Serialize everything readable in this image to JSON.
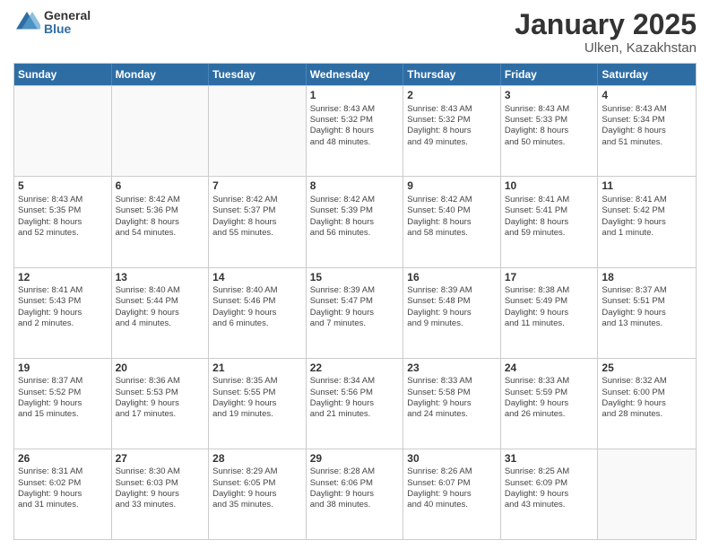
{
  "logo": {
    "general": "General",
    "blue": "Blue"
  },
  "title": {
    "month": "January 2025",
    "location": "Ulken, Kazakhstan"
  },
  "calendar": {
    "headers": [
      "Sunday",
      "Monday",
      "Tuesday",
      "Wednesday",
      "Thursday",
      "Friday",
      "Saturday"
    ],
    "rows": [
      [
        {
          "day": "",
          "info": "",
          "empty": true
        },
        {
          "day": "",
          "info": "",
          "empty": true
        },
        {
          "day": "",
          "info": "",
          "empty": true
        },
        {
          "day": "1",
          "info": "Sunrise: 8:43 AM\nSunset: 5:32 PM\nDaylight: 8 hours\nand 48 minutes.",
          "empty": false
        },
        {
          "day": "2",
          "info": "Sunrise: 8:43 AM\nSunset: 5:32 PM\nDaylight: 8 hours\nand 49 minutes.",
          "empty": false
        },
        {
          "day": "3",
          "info": "Sunrise: 8:43 AM\nSunset: 5:33 PM\nDaylight: 8 hours\nand 50 minutes.",
          "empty": false
        },
        {
          "day": "4",
          "info": "Sunrise: 8:43 AM\nSunset: 5:34 PM\nDaylight: 8 hours\nand 51 minutes.",
          "empty": false
        }
      ],
      [
        {
          "day": "5",
          "info": "Sunrise: 8:43 AM\nSunset: 5:35 PM\nDaylight: 8 hours\nand 52 minutes.",
          "empty": false
        },
        {
          "day": "6",
          "info": "Sunrise: 8:42 AM\nSunset: 5:36 PM\nDaylight: 8 hours\nand 54 minutes.",
          "empty": false
        },
        {
          "day": "7",
          "info": "Sunrise: 8:42 AM\nSunset: 5:37 PM\nDaylight: 8 hours\nand 55 minutes.",
          "empty": false
        },
        {
          "day": "8",
          "info": "Sunrise: 8:42 AM\nSunset: 5:39 PM\nDaylight: 8 hours\nand 56 minutes.",
          "empty": false
        },
        {
          "day": "9",
          "info": "Sunrise: 8:42 AM\nSunset: 5:40 PM\nDaylight: 8 hours\nand 58 minutes.",
          "empty": false
        },
        {
          "day": "10",
          "info": "Sunrise: 8:41 AM\nSunset: 5:41 PM\nDaylight: 8 hours\nand 59 minutes.",
          "empty": false
        },
        {
          "day": "11",
          "info": "Sunrise: 8:41 AM\nSunset: 5:42 PM\nDaylight: 9 hours\nand 1 minute.",
          "empty": false
        }
      ],
      [
        {
          "day": "12",
          "info": "Sunrise: 8:41 AM\nSunset: 5:43 PM\nDaylight: 9 hours\nand 2 minutes.",
          "empty": false
        },
        {
          "day": "13",
          "info": "Sunrise: 8:40 AM\nSunset: 5:44 PM\nDaylight: 9 hours\nand 4 minutes.",
          "empty": false
        },
        {
          "day": "14",
          "info": "Sunrise: 8:40 AM\nSunset: 5:46 PM\nDaylight: 9 hours\nand 6 minutes.",
          "empty": false
        },
        {
          "day": "15",
          "info": "Sunrise: 8:39 AM\nSunset: 5:47 PM\nDaylight: 9 hours\nand 7 minutes.",
          "empty": false
        },
        {
          "day": "16",
          "info": "Sunrise: 8:39 AM\nSunset: 5:48 PM\nDaylight: 9 hours\nand 9 minutes.",
          "empty": false
        },
        {
          "day": "17",
          "info": "Sunrise: 8:38 AM\nSunset: 5:49 PM\nDaylight: 9 hours\nand 11 minutes.",
          "empty": false
        },
        {
          "day": "18",
          "info": "Sunrise: 8:37 AM\nSunset: 5:51 PM\nDaylight: 9 hours\nand 13 minutes.",
          "empty": false
        }
      ],
      [
        {
          "day": "19",
          "info": "Sunrise: 8:37 AM\nSunset: 5:52 PM\nDaylight: 9 hours\nand 15 minutes.",
          "empty": false
        },
        {
          "day": "20",
          "info": "Sunrise: 8:36 AM\nSunset: 5:53 PM\nDaylight: 9 hours\nand 17 minutes.",
          "empty": false
        },
        {
          "day": "21",
          "info": "Sunrise: 8:35 AM\nSunset: 5:55 PM\nDaylight: 9 hours\nand 19 minutes.",
          "empty": false
        },
        {
          "day": "22",
          "info": "Sunrise: 8:34 AM\nSunset: 5:56 PM\nDaylight: 9 hours\nand 21 minutes.",
          "empty": false
        },
        {
          "day": "23",
          "info": "Sunrise: 8:33 AM\nSunset: 5:58 PM\nDaylight: 9 hours\nand 24 minutes.",
          "empty": false
        },
        {
          "day": "24",
          "info": "Sunrise: 8:33 AM\nSunset: 5:59 PM\nDaylight: 9 hours\nand 26 minutes.",
          "empty": false
        },
        {
          "day": "25",
          "info": "Sunrise: 8:32 AM\nSunset: 6:00 PM\nDaylight: 9 hours\nand 28 minutes.",
          "empty": false
        }
      ],
      [
        {
          "day": "26",
          "info": "Sunrise: 8:31 AM\nSunset: 6:02 PM\nDaylight: 9 hours\nand 31 minutes.",
          "empty": false
        },
        {
          "day": "27",
          "info": "Sunrise: 8:30 AM\nSunset: 6:03 PM\nDaylight: 9 hours\nand 33 minutes.",
          "empty": false
        },
        {
          "day": "28",
          "info": "Sunrise: 8:29 AM\nSunset: 6:05 PM\nDaylight: 9 hours\nand 35 minutes.",
          "empty": false
        },
        {
          "day": "29",
          "info": "Sunrise: 8:28 AM\nSunset: 6:06 PM\nDaylight: 9 hours\nand 38 minutes.",
          "empty": false
        },
        {
          "day": "30",
          "info": "Sunrise: 8:26 AM\nSunset: 6:07 PM\nDaylight: 9 hours\nand 40 minutes.",
          "empty": false
        },
        {
          "day": "31",
          "info": "Sunrise: 8:25 AM\nSunset: 6:09 PM\nDaylight: 9 hours\nand 43 minutes.",
          "empty": false
        },
        {
          "day": "",
          "info": "",
          "empty": true
        }
      ]
    ]
  }
}
